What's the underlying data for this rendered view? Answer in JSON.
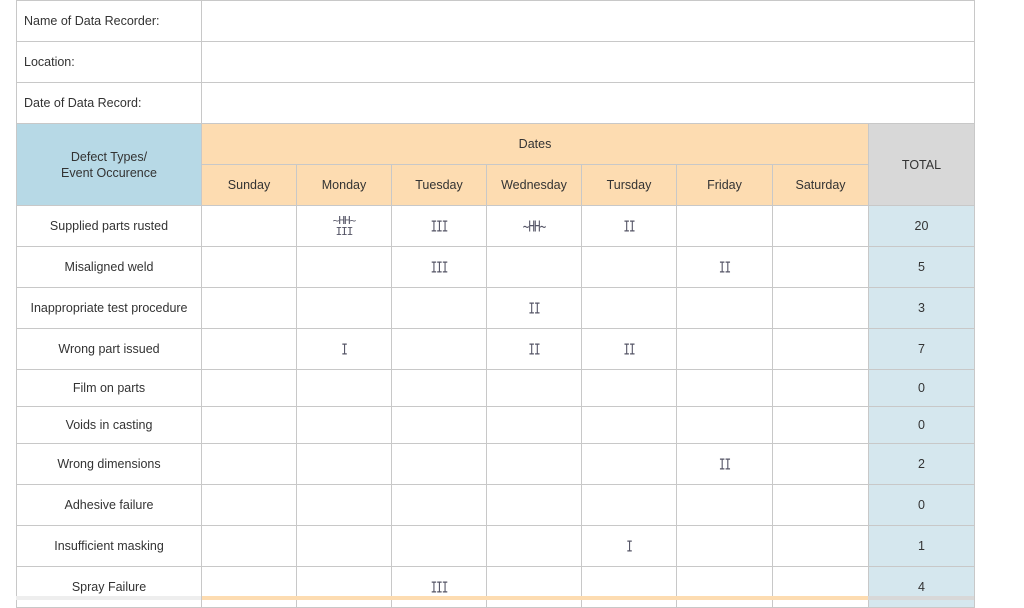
{
  "info": {
    "recorder_label": "Name of Data Recorder:",
    "location_label": "Location:",
    "date_label": "Date of Data Record:"
  },
  "header": {
    "defect_line1": "Defect Types/",
    "defect_line2": "Event Occurence",
    "dates": "Dates",
    "total": "TOTAL",
    "days": [
      "Sunday",
      "Monday",
      "Tuesday",
      "Wednesday",
      "Tursday",
      "Friday",
      "Saturday"
    ]
  },
  "rows": [
    {
      "type": "Supplied parts rusted",
      "tallies": [
        "",
        "~HH~\nIII",
        "III",
        "~HH~",
        "II",
        "",
        ""
      ],
      "total": "20"
    },
    {
      "type": "Misaligned weld",
      "tallies": [
        "",
        "",
        "III",
        "",
        "",
        "II",
        ""
      ],
      "total": "5"
    },
    {
      "type": "Inappropriate test procedure",
      "tallies": [
        "",
        "",
        "",
        "II",
        "",
        "",
        ""
      ],
      "total": "3"
    },
    {
      "type": "Wrong part issued",
      "tallies": [
        "",
        "I",
        "",
        "II",
        "II",
        "",
        ""
      ],
      "total": "7"
    },
    {
      "type": "Film on parts",
      "tallies": [
        "",
        "",
        "",
        "",
        "",
        "",
        ""
      ],
      "total": "0"
    },
    {
      "type": "Voids in casting",
      "tallies": [
        "",
        "",
        "",
        "",
        "",
        "",
        ""
      ],
      "total": "0"
    },
    {
      "type": "Wrong dimensions",
      "tallies": [
        "",
        "",
        "",
        "",
        "",
        "II",
        ""
      ],
      "total": "2"
    },
    {
      "type": "Adhesive failure",
      "tallies": [
        "",
        "",
        "",
        "",
        "",
        "",
        ""
      ],
      "total": "0"
    },
    {
      "type": "Insufficient masking",
      "tallies": [
        "",
        "",
        "",
        "",
        "I",
        "",
        ""
      ],
      "total": "1"
    },
    {
      "type": "Spray Failure",
      "tallies": [
        "",
        "",
        "III",
        "",
        "",
        "",
        ""
      ],
      "total": "4"
    }
  ],
  "colors": {
    "defect_header": "#b7d9e6",
    "dates_header": "#fddcb1",
    "total_header": "#d8d8d8",
    "total_cells": "#d5e7ee",
    "grid": "#c8c8c8"
  }
}
